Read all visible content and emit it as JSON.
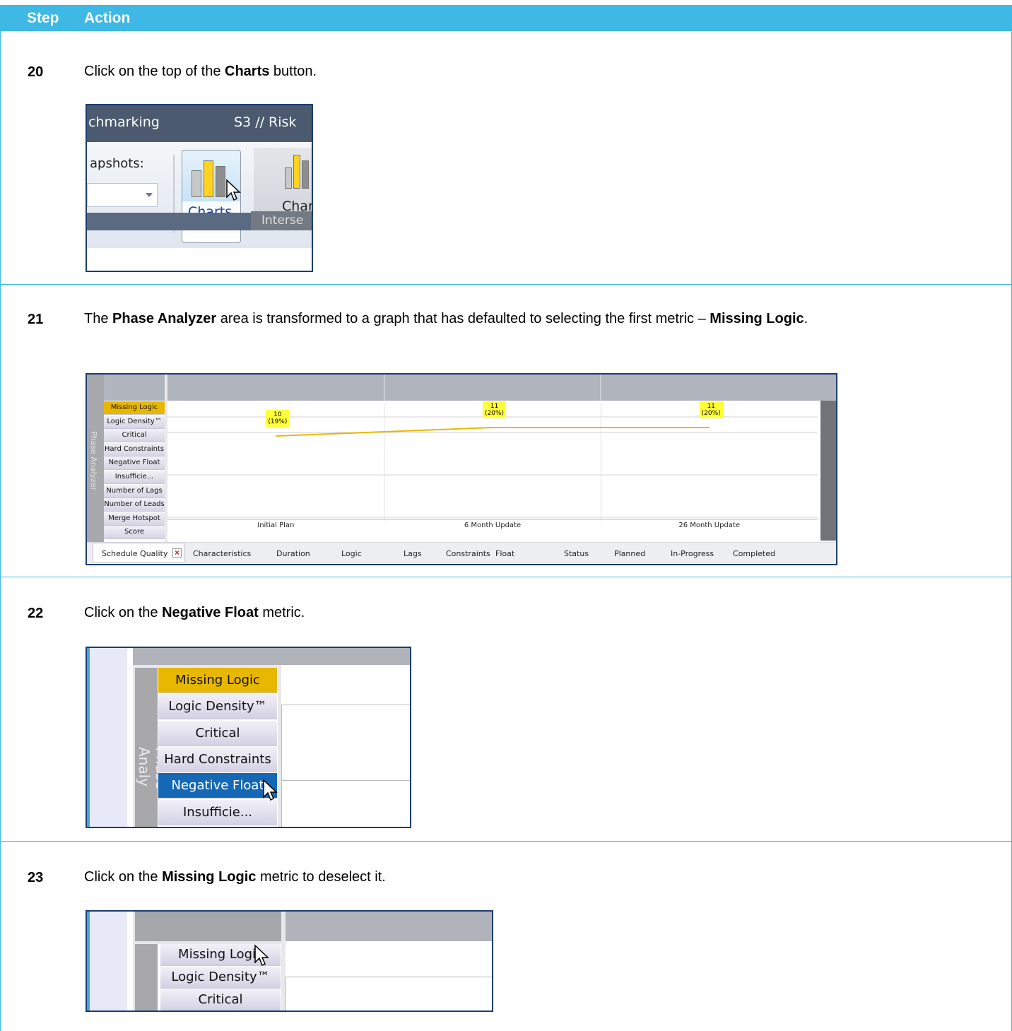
{
  "header": {
    "step": "Step",
    "action": "Action"
  },
  "steps": [
    {
      "num": "20",
      "pre": "Click on the top of the ",
      "bold": "Charts",
      "post": " button."
    },
    {
      "num": "21",
      "pre": "The ",
      "bold": "Phase Analyzer",
      "mid": " area is transformed to a graph that has defaulted to selecting the first metric – ",
      "bold2": "Missing Logic",
      "post": "."
    },
    {
      "num": "22",
      "pre": "Click on the ",
      "bold": "Negative Float",
      "post": " metric."
    },
    {
      "num": "23",
      "pre": "Click on the ",
      "bold": "Missing Logic",
      "post": " metric to deselect it."
    }
  ],
  "ribbon": {
    "tab_left": "chmarking",
    "tab_right": "S3 // Risk",
    "snapshots_label": "apshots:",
    "charts_label": "Charts",
    "charts2_label": "Char",
    "footer_label": "Interse"
  },
  "phase_analyzer": {
    "side_label": "Phase Analyzer",
    "metrics": [
      "Missing Logic",
      "Logic Density™",
      "Critical",
      "Hard Constraints",
      "Negative Float",
      "Insufficie...",
      "Number of Lags",
      "Number of Leads",
      "Merge Hotspot",
      "Score"
    ],
    "selected_metric": "Missing Logic",
    "tabs": [
      "Schedule Quality",
      "Characteristics",
      "Duration",
      "Logic",
      "Lags",
      "Constraints",
      "Float",
      "Status",
      "Planned",
      "In-Progress",
      "Completed"
    ],
    "tab_close_icon": "×",
    "accent_colors": {
      "selected": "#e8b800",
      "line": "#e8b800",
      "label_bg": "#ffff3a"
    }
  },
  "chart_data": {
    "type": "line",
    "categories": [
      "Initial  Plan",
      "6 Month Update",
      "26 Month Update"
    ],
    "series": [
      {
        "name": "Missing Logic",
        "values": [
          10,
          11,
          11
        ],
        "labels": [
          "10\n(19%)",
          "11\n(20%)",
          "11\n(20%)"
        ]
      }
    ]
  },
  "zoom22": {
    "side_label": "Phase Analy",
    "metrics": [
      "Missing Logic",
      "Logic Density™",
      "Critical",
      "Hard Constraints",
      "Negative Float",
      "Insufficie..."
    ],
    "yellow": "Missing Logic",
    "blue": "Negative Float"
  },
  "zoom23": {
    "metrics": [
      "Missing Logic",
      "Logic Density™",
      "Critical"
    ]
  }
}
